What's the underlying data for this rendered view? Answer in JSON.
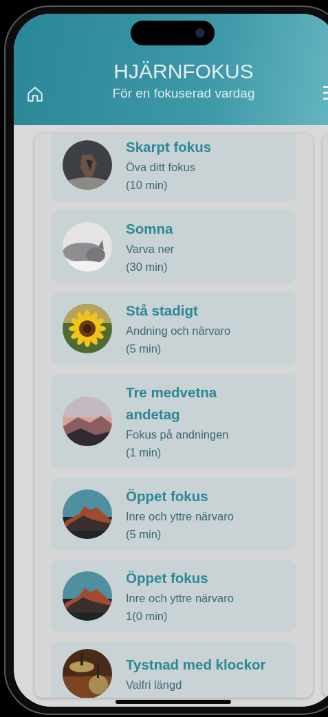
{
  "header": {
    "title": "HJÄRNFOKUS",
    "subtitle": "För en fokuserad vardag"
  },
  "exercises": [
    {
      "title": "Skarpt fokus",
      "lines": [
        "Öva ditt fokus",
        "(10 min)"
      ],
      "kind": "picture"
    },
    {
      "title": "Somna",
      "lines": [
        "Varva ner",
        "(30 min)"
      ],
      "kind": "picture"
    },
    {
      "title": "Stå stadigt",
      "lines": [
        "Andning och närvaro",
        "(5 min)"
      ],
      "kind": "picture"
    },
    {
      "title": "Tre medvetna andetag",
      "lines": [
        "Fokus på andningen",
        "(1 min)"
      ],
      "kind": "picture"
    },
    {
      "title": "Öppet fokus",
      "lines": [
        "Inre och yttre närvaro",
        "(5 min)"
      ],
      "kind": "picture"
    },
    {
      "title": "Öppet fokus",
      "lines": [
        "Inre och yttre närvaro",
        "1(0 min)"
      ],
      "kind": "picture"
    },
    {
      "title": "Tystnad med klockor",
      "lines": [
        "Valfri längd"
      ],
      "kind": "picture"
    }
  ]
}
